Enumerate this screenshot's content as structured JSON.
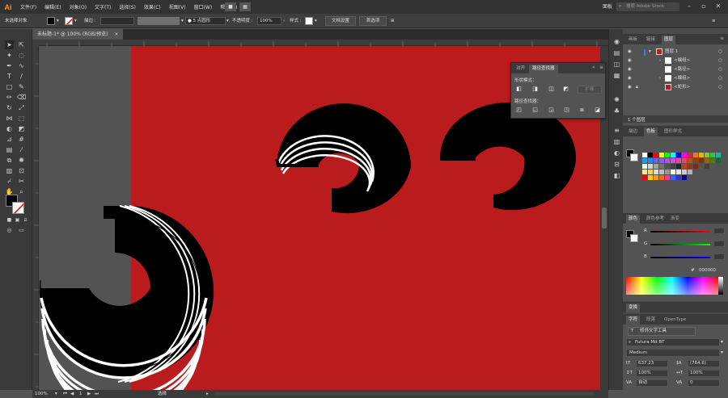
{
  "menubar": {
    "logo": "Ai",
    "items": [
      "文件(F)",
      "编辑(E)",
      "对象(O)",
      "文字(T)",
      "选择(S)",
      "效果(C)",
      "视图(V)",
      "窗口(W)",
      "帮助(H)"
    ],
    "workspace": "面板",
    "stock_search_placeholder": "搜索 Adobe Stock"
  },
  "controlbar": {
    "selection_status": "未选择对象",
    "stroke_label": "描边 :",
    "stroke_size": "5 点圆形",
    "opacity_label": "不透明度 :",
    "opacity_value": "100%",
    "style_label": "样式 :",
    "doc_setup_button": "文档设置",
    "prefs_button": "首选项"
  },
  "document": {
    "tab_title": "未标题-1* @ 100% (RGB/预览)",
    "close_glyph": "×"
  },
  "statusbar": {
    "zoom": "100%",
    "page": "1",
    "mode": "选择"
  },
  "pathfinder": {
    "tabs": [
      "对齐",
      "路径查找器"
    ],
    "active_tab": "路径查找器",
    "shape_modes_label": "形状模式：",
    "expand_button": "扩展",
    "pathfinders_label": "路径查找器："
  },
  "layers_panel": {
    "tabs": [
      "画板",
      "链接",
      "图层"
    ],
    "active_tab": "图层",
    "rows": [
      {
        "name": "图层 1",
        "indent": 0,
        "expanded": true
      },
      {
        "name": "<编组>",
        "indent": 1,
        "expanded": false
      },
      {
        "name": "<路径>",
        "indent": 1,
        "expanded": false
      },
      {
        "name": "<编组>",
        "indent": 1,
        "expanded": false
      },
      {
        "name": "<矩形>",
        "indent": 1,
        "expanded": false
      }
    ],
    "footer": "1 个图层"
  },
  "swatches_panel": {
    "tabs": [
      "描边",
      "色板",
      "图形样式"
    ],
    "active_tab": "色板"
  },
  "color_panel": {
    "tabs": [
      "颜色",
      "颜色参考",
      "渐变"
    ],
    "active_tab": "颜色",
    "channels": [
      "R",
      "G",
      "B"
    ],
    "hex_symbol": "#",
    "hex": "000000"
  },
  "transform_panel": {
    "title": "变换"
  },
  "character_panel": {
    "tabs": [
      "字符",
      "段落",
      "OpenType"
    ],
    "active_tab": "字符",
    "touch_tool_button": "修饰文字工具",
    "font_search_glyph": "⌕",
    "font_family": "Futura Md BT",
    "font_style": "Medium",
    "font_size": "637.23",
    "leading": "(764.6)",
    "scale_v": "100%",
    "scale_h": "100%",
    "tracking": "自动",
    "kerning": "0"
  },
  "colors": {
    "artboard": "#ba1b1c",
    "ui_dark": "#323232",
    "ui_mid": "#535353",
    "logo": "#ff9a00"
  }
}
